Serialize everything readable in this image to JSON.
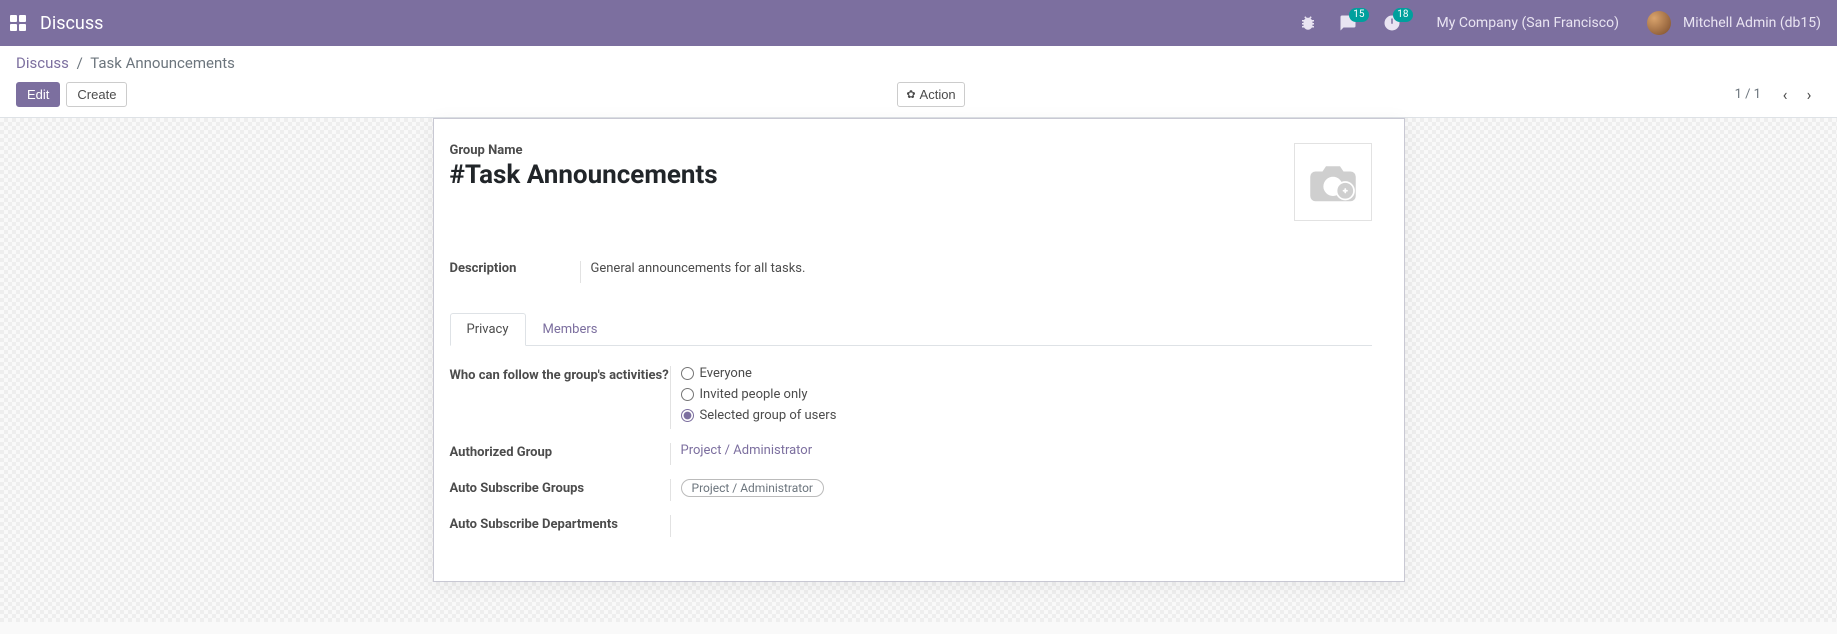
{
  "navbar": {
    "app_title": "Discuss",
    "company": "My Company (San Francisco)",
    "user": "Mitchell Admin (db15)",
    "messages_badge": "15",
    "activities_badge": "18"
  },
  "breadcrumb": {
    "root": "Discuss",
    "current": "Task Announcements",
    "separator": "/"
  },
  "toolbar": {
    "edit": "Edit",
    "create": "Create",
    "action": "Action"
  },
  "pager": {
    "value": "1 / 1"
  },
  "form": {
    "group_name_label": "Group Name",
    "group_name_value": "#Task Announcements",
    "description_label": "Description",
    "description_value": "General announcements for all tasks."
  },
  "tabs": {
    "privacy": "Privacy",
    "members": "Members"
  },
  "fields": {
    "who_follow_label": "Who can follow the group's activities?",
    "opt_everyone": "Everyone",
    "opt_invited": "Invited people only",
    "opt_selected": "Selected group of users",
    "authorized_group_label": "Authorized Group",
    "authorized_group_value": "Project / Administrator",
    "auto_sub_groups_label": "Auto Subscribe Groups",
    "auto_sub_groups_tag": "Project / Administrator",
    "auto_sub_depts_label": "Auto Subscribe Departments"
  },
  "colors": {
    "primary": "#7c6f9f",
    "badge": "#00a09d"
  }
}
